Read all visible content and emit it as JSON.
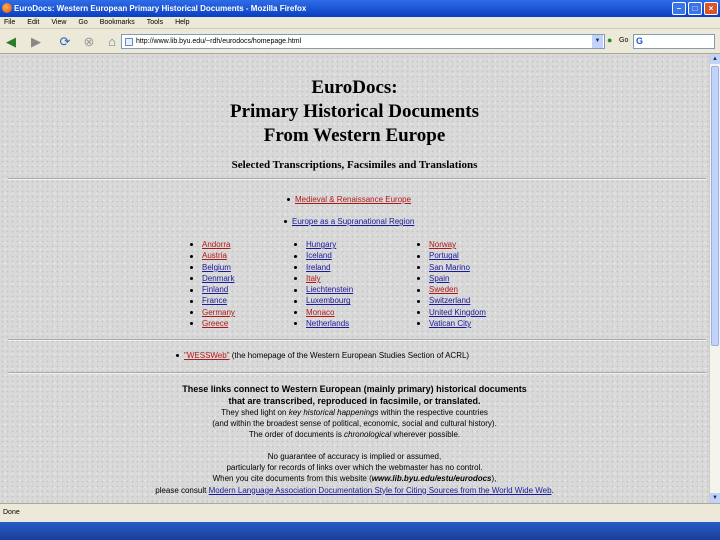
{
  "window": {
    "title": "EuroDocs: Western European Primary Historical Documents - Mozilla Firefox"
  },
  "menu": [
    "File",
    "Edit",
    "View",
    "Go",
    "Bookmarks",
    "Tools",
    "Help"
  ],
  "nav": {
    "url": "http://www.lib.byu.edu/~rdh/eurodocs/homepage.html",
    "go_label": "Go",
    "search_placeholder": ""
  },
  "page": {
    "title_lines": [
      "EuroDocs:",
      "Primary Historical Documents",
      "From Western Europe"
    ],
    "subtitle": "Selected Transcriptions, Facsimiles and Translations",
    "medieval": "Medieval & Renaissance Europe",
    "supranational": "Europe as a Supranational Region",
    "countries_col1": [
      "Andorra",
      "Austria",
      "Belgium",
      "Denmark",
      "Finland",
      "France",
      "Germany",
      "Greece"
    ],
    "countries_col2": [
      "Hungary",
      "Iceland",
      "Ireland",
      "Italy",
      "Liechtenstein",
      "Luxembourg",
      "Monaco",
      "Netherlands"
    ],
    "countries_col3": [
      "Norway",
      "Portugal",
      "San Marino",
      "Spain",
      "Sweden",
      "Switzerland",
      "United Kingdom",
      "Vatican City"
    ],
    "westweb_link": "\"WESSWeb\"",
    "westweb_text": " (the homepage of the Western European Studies Section of ACRL)",
    "intro_bold_1": "These links connect to Western European (mainly primary) historical documents",
    "intro_bold_2": "that are transcribed, reproduced in facsimile, or translated.",
    "intro_3a": "They shed light on ",
    "intro_3b": "key historical happenings",
    "intro_3c": " within the respective countries",
    "intro_4": "(and within the broadest sense of political, economic, social and cultural history).",
    "intro_5a": "The order of documents is ",
    "intro_5b": "chronological",
    "intro_5c": " wherever possible.",
    "disclaimer_1": "No guarantee of accuracy is implied or assumed,",
    "disclaimer_2": "particularly for records of links over which the webmaster has no control.",
    "cite_a": "When you cite documents from this website (",
    "cite_b": "www.lib.byu.edu/estu/eurodocs",
    "cite_c": "),",
    "mla_a": "please consult ",
    "mla_link": "Modern Language Association Documentation Style for Citing Sources from the World Wide Web",
    "mla_c": "."
  },
  "status": {
    "text": "Done"
  }
}
